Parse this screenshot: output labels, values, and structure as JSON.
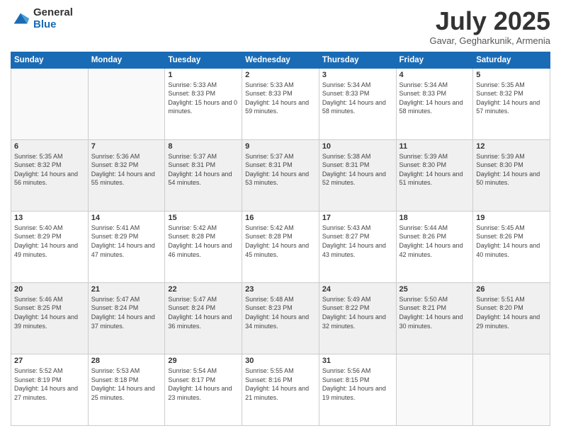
{
  "logo": {
    "general": "General",
    "blue": "Blue"
  },
  "header": {
    "month": "July 2025",
    "location": "Gavar, Gegharkunik, Armenia"
  },
  "days_of_week": [
    "Sunday",
    "Monday",
    "Tuesday",
    "Wednesday",
    "Thursday",
    "Friday",
    "Saturday"
  ],
  "weeks": [
    [
      {
        "day": "",
        "info": ""
      },
      {
        "day": "",
        "info": ""
      },
      {
        "day": "1",
        "info": "Sunrise: 5:33 AM\nSunset: 8:33 PM\nDaylight: 15 hours and 0 minutes."
      },
      {
        "day": "2",
        "info": "Sunrise: 5:33 AM\nSunset: 8:33 PM\nDaylight: 14 hours and 59 minutes."
      },
      {
        "day": "3",
        "info": "Sunrise: 5:34 AM\nSunset: 8:33 PM\nDaylight: 14 hours and 58 minutes."
      },
      {
        "day": "4",
        "info": "Sunrise: 5:34 AM\nSunset: 8:33 PM\nDaylight: 14 hours and 58 minutes."
      },
      {
        "day": "5",
        "info": "Sunrise: 5:35 AM\nSunset: 8:32 PM\nDaylight: 14 hours and 57 minutes."
      }
    ],
    [
      {
        "day": "6",
        "info": "Sunrise: 5:35 AM\nSunset: 8:32 PM\nDaylight: 14 hours and 56 minutes."
      },
      {
        "day": "7",
        "info": "Sunrise: 5:36 AM\nSunset: 8:32 PM\nDaylight: 14 hours and 55 minutes."
      },
      {
        "day": "8",
        "info": "Sunrise: 5:37 AM\nSunset: 8:31 PM\nDaylight: 14 hours and 54 minutes."
      },
      {
        "day": "9",
        "info": "Sunrise: 5:37 AM\nSunset: 8:31 PM\nDaylight: 14 hours and 53 minutes."
      },
      {
        "day": "10",
        "info": "Sunrise: 5:38 AM\nSunset: 8:31 PM\nDaylight: 14 hours and 52 minutes."
      },
      {
        "day": "11",
        "info": "Sunrise: 5:39 AM\nSunset: 8:30 PM\nDaylight: 14 hours and 51 minutes."
      },
      {
        "day": "12",
        "info": "Sunrise: 5:39 AM\nSunset: 8:30 PM\nDaylight: 14 hours and 50 minutes."
      }
    ],
    [
      {
        "day": "13",
        "info": "Sunrise: 5:40 AM\nSunset: 8:29 PM\nDaylight: 14 hours and 49 minutes."
      },
      {
        "day": "14",
        "info": "Sunrise: 5:41 AM\nSunset: 8:29 PM\nDaylight: 14 hours and 47 minutes."
      },
      {
        "day": "15",
        "info": "Sunrise: 5:42 AM\nSunset: 8:28 PM\nDaylight: 14 hours and 46 minutes."
      },
      {
        "day": "16",
        "info": "Sunrise: 5:42 AM\nSunset: 8:28 PM\nDaylight: 14 hours and 45 minutes."
      },
      {
        "day": "17",
        "info": "Sunrise: 5:43 AM\nSunset: 8:27 PM\nDaylight: 14 hours and 43 minutes."
      },
      {
        "day": "18",
        "info": "Sunrise: 5:44 AM\nSunset: 8:26 PM\nDaylight: 14 hours and 42 minutes."
      },
      {
        "day": "19",
        "info": "Sunrise: 5:45 AM\nSunset: 8:26 PM\nDaylight: 14 hours and 40 minutes."
      }
    ],
    [
      {
        "day": "20",
        "info": "Sunrise: 5:46 AM\nSunset: 8:25 PM\nDaylight: 14 hours and 39 minutes."
      },
      {
        "day": "21",
        "info": "Sunrise: 5:47 AM\nSunset: 8:24 PM\nDaylight: 14 hours and 37 minutes."
      },
      {
        "day": "22",
        "info": "Sunrise: 5:47 AM\nSunset: 8:24 PM\nDaylight: 14 hours and 36 minutes."
      },
      {
        "day": "23",
        "info": "Sunrise: 5:48 AM\nSunset: 8:23 PM\nDaylight: 14 hours and 34 minutes."
      },
      {
        "day": "24",
        "info": "Sunrise: 5:49 AM\nSunset: 8:22 PM\nDaylight: 14 hours and 32 minutes."
      },
      {
        "day": "25",
        "info": "Sunrise: 5:50 AM\nSunset: 8:21 PM\nDaylight: 14 hours and 30 minutes."
      },
      {
        "day": "26",
        "info": "Sunrise: 5:51 AM\nSunset: 8:20 PM\nDaylight: 14 hours and 29 minutes."
      }
    ],
    [
      {
        "day": "27",
        "info": "Sunrise: 5:52 AM\nSunset: 8:19 PM\nDaylight: 14 hours and 27 minutes."
      },
      {
        "day": "28",
        "info": "Sunrise: 5:53 AM\nSunset: 8:18 PM\nDaylight: 14 hours and 25 minutes."
      },
      {
        "day": "29",
        "info": "Sunrise: 5:54 AM\nSunset: 8:17 PM\nDaylight: 14 hours and 23 minutes."
      },
      {
        "day": "30",
        "info": "Sunrise: 5:55 AM\nSunset: 8:16 PM\nDaylight: 14 hours and 21 minutes."
      },
      {
        "day": "31",
        "info": "Sunrise: 5:56 AM\nSunset: 8:15 PM\nDaylight: 14 hours and 19 minutes."
      },
      {
        "day": "",
        "info": ""
      },
      {
        "day": "",
        "info": ""
      }
    ]
  ]
}
